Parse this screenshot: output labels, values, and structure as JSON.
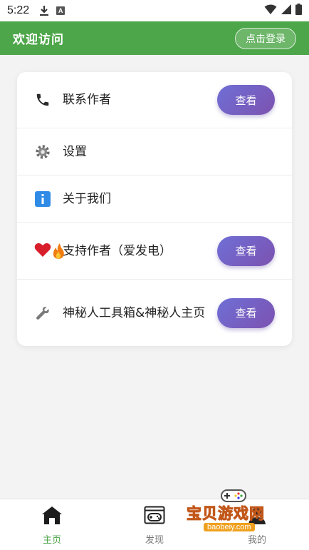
{
  "status_bar": {
    "time": "5:22"
  },
  "header": {
    "title": "欢迎访问",
    "login_label": "点击登录"
  },
  "menu": {
    "items": [
      {
        "label": "联系作者",
        "icon": "phone-icon",
        "button": "查看"
      },
      {
        "label": "设置",
        "icon": "gear-icon"
      },
      {
        "label": "关于我们",
        "icon": "info-icon"
      },
      {
        "label": "支持作者（爱发电）",
        "icon": "heart-fire-icon",
        "button": "查看"
      },
      {
        "label": "神秘人工具箱&神秘人主页",
        "icon": "wrench-icon",
        "button": "查看"
      }
    ]
  },
  "bottom_nav": {
    "items": [
      {
        "label": "主页",
        "icon": "home-icon",
        "active": true
      },
      {
        "label": "发现",
        "icon": "gamepad-icon",
        "active": false
      },
      {
        "label": "我的",
        "icon": "user-icon",
        "active": false
      }
    ]
  },
  "watermark": {
    "text": "宝贝游戏网",
    "url": "baobeiy.com"
  },
  "colors": {
    "primary": "#4ea64a",
    "button_gradient": [
      "#6f6fd6",
      "#7c52b0"
    ]
  }
}
